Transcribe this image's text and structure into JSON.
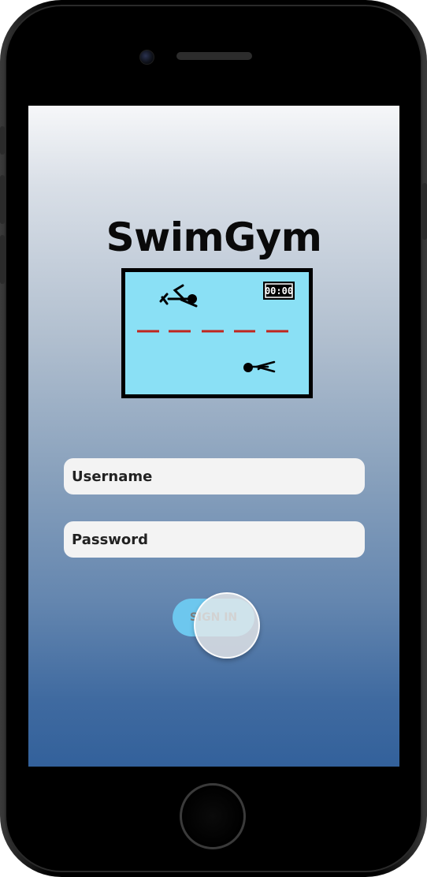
{
  "app": {
    "title": "SwimGym"
  },
  "logo": {
    "timer_text": "00:00",
    "pool_color": "#8ae0f5",
    "lane_line_color": "#c0261e",
    "icons": [
      "swimmer-icon",
      "swimmer-icon",
      "timer-icon"
    ]
  },
  "form": {
    "username_placeholder": "Username",
    "password_placeholder": "Password",
    "signin_label": "SIGN IN"
  },
  "colors": {
    "button": "#6dc7ee",
    "field_background": "#f3f3f3",
    "gradient_top": "#f6f7f9",
    "gradient_bottom": "#33619b"
  }
}
